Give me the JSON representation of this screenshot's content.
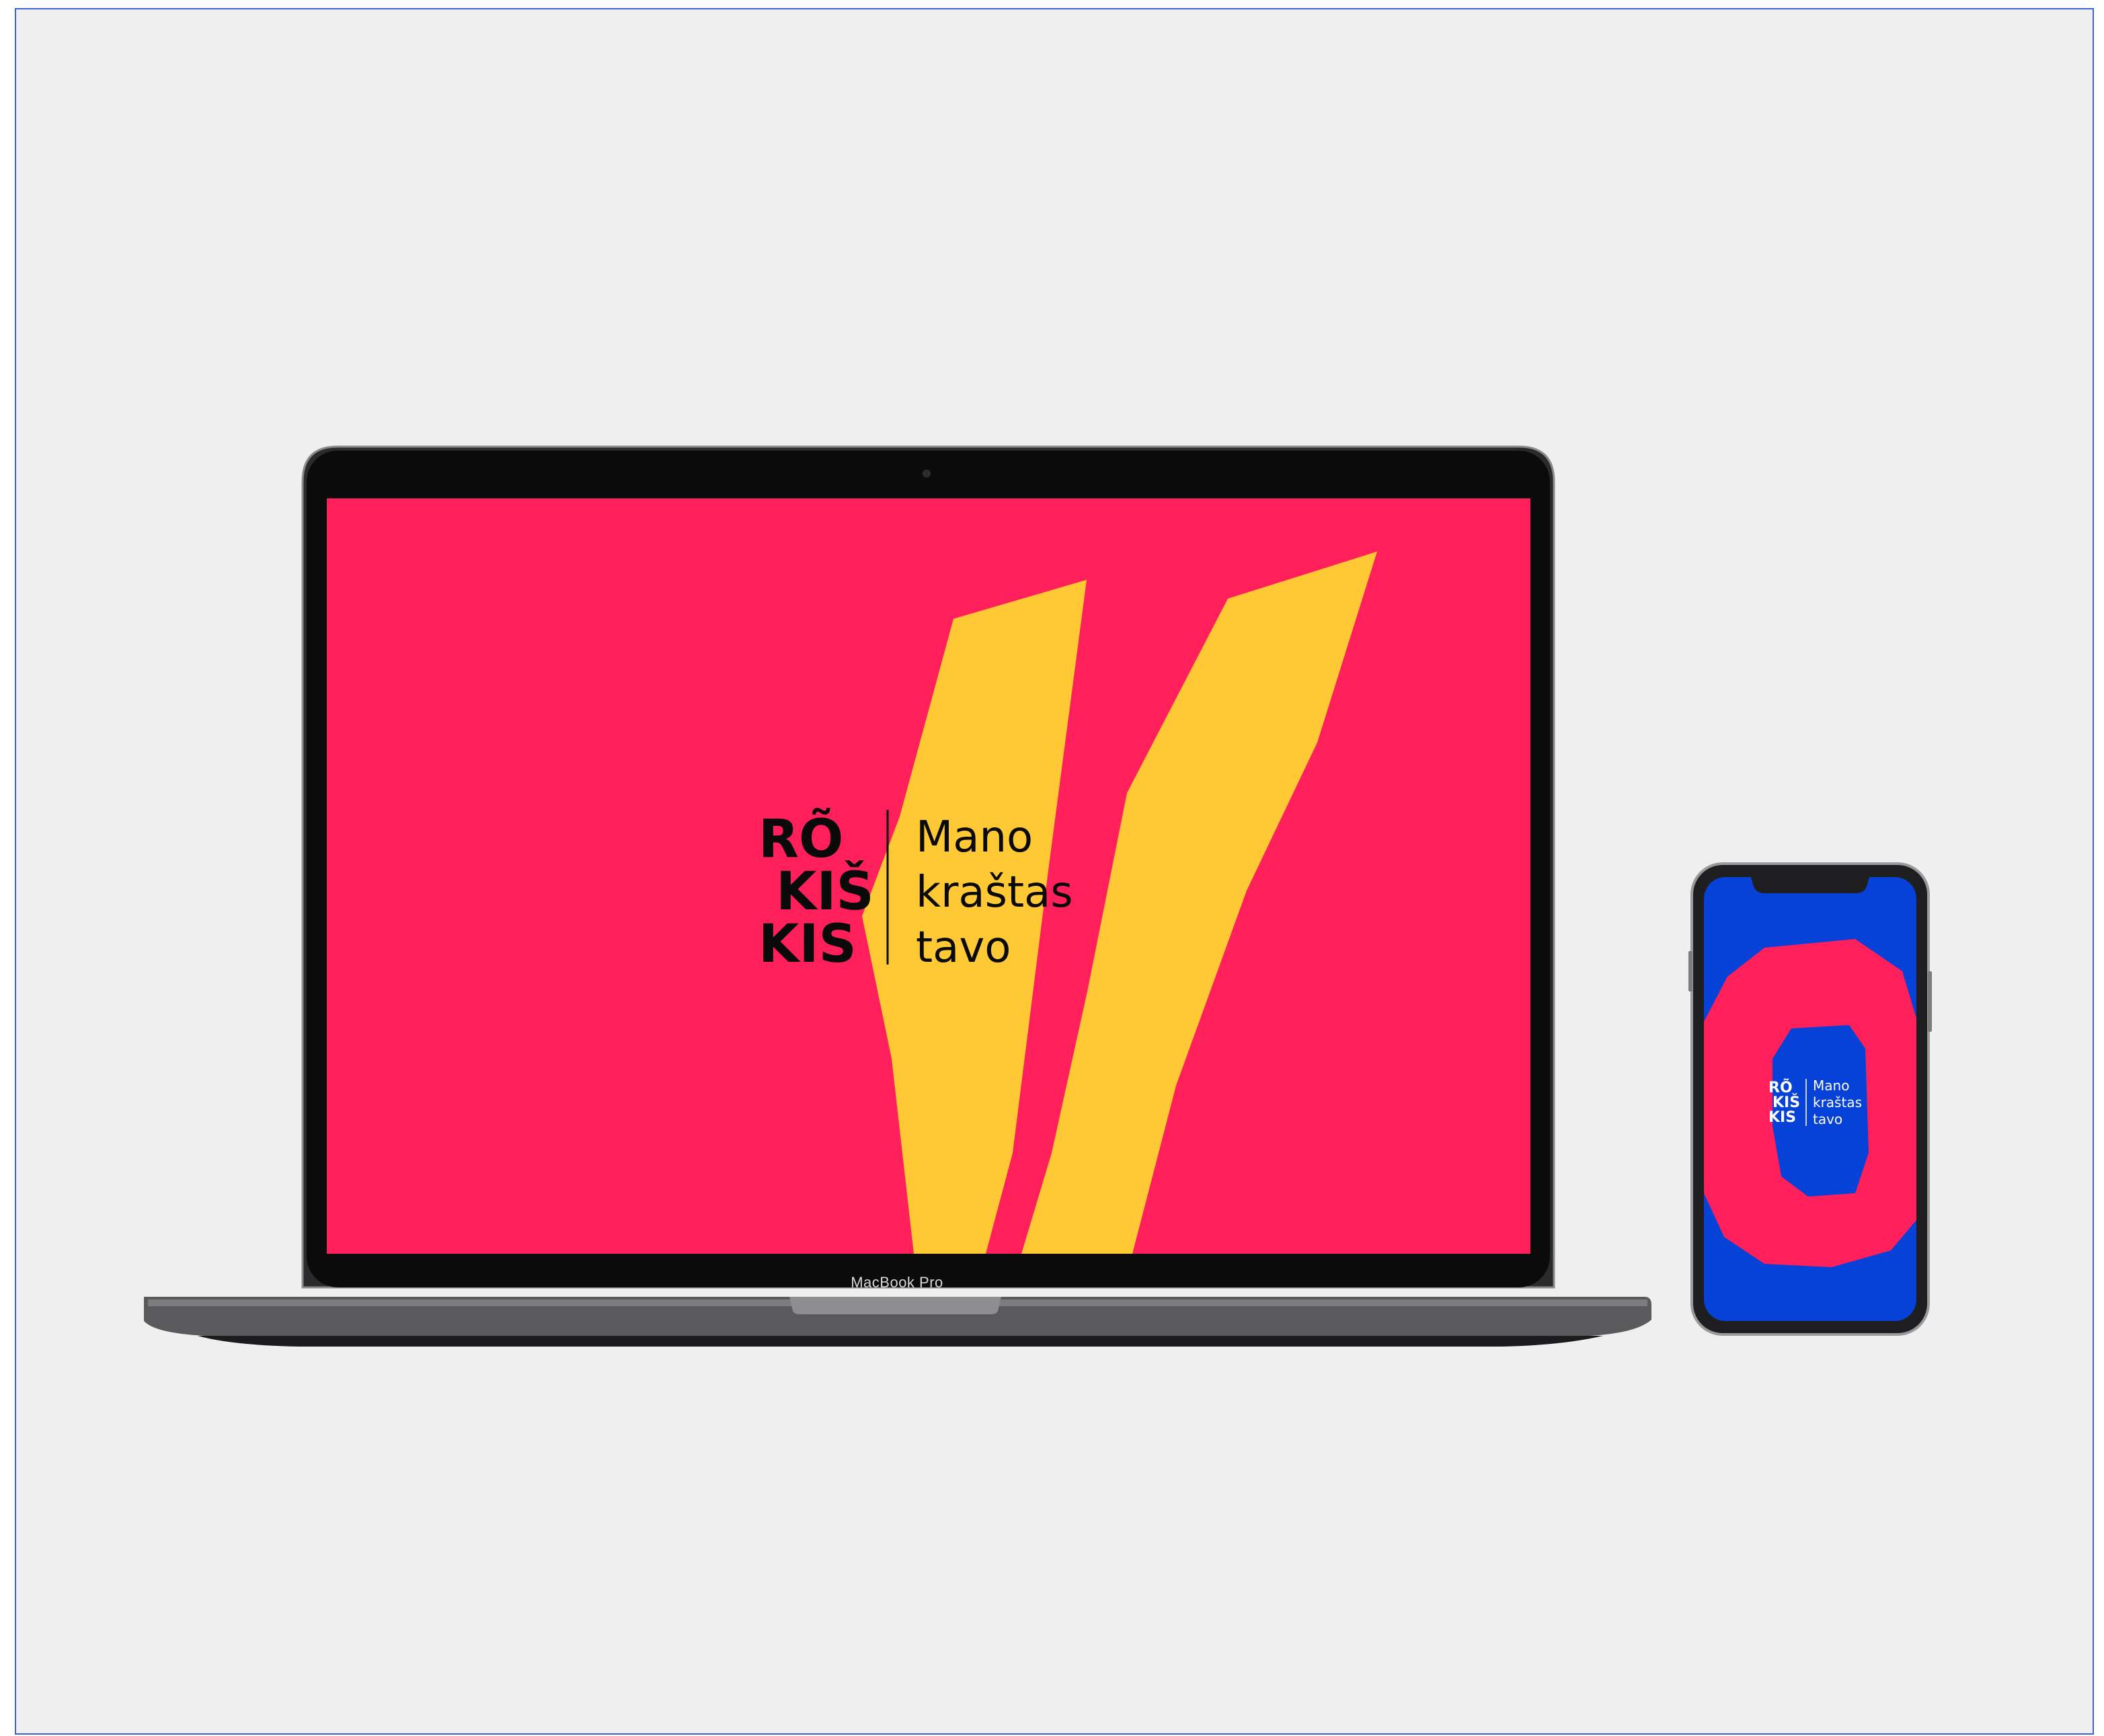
{
  "laptop": {
    "model_label": "MacBook Pro",
    "screen_background": "#ff1f5a",
    "accent": "#ffc835"
  },
  "brand": {
    "logo_letters": [
      "RÕ",
      "KIŠ",
      "KIS"
    ],
    "tagline": [
      "Mano",
      "kraštas",
      "tavo"
    ]
  },
  "phone": {
    "screen_background": "#0642d8",
    "ring_color": "#ff1f5a",
    "logo_letters": [
      "RÕ",
      "KIŠ",
      "KIS"
    ],
    "tagline": [
      "Mano",
      "kraštas",
      "tavo"
    ]
  }
}
